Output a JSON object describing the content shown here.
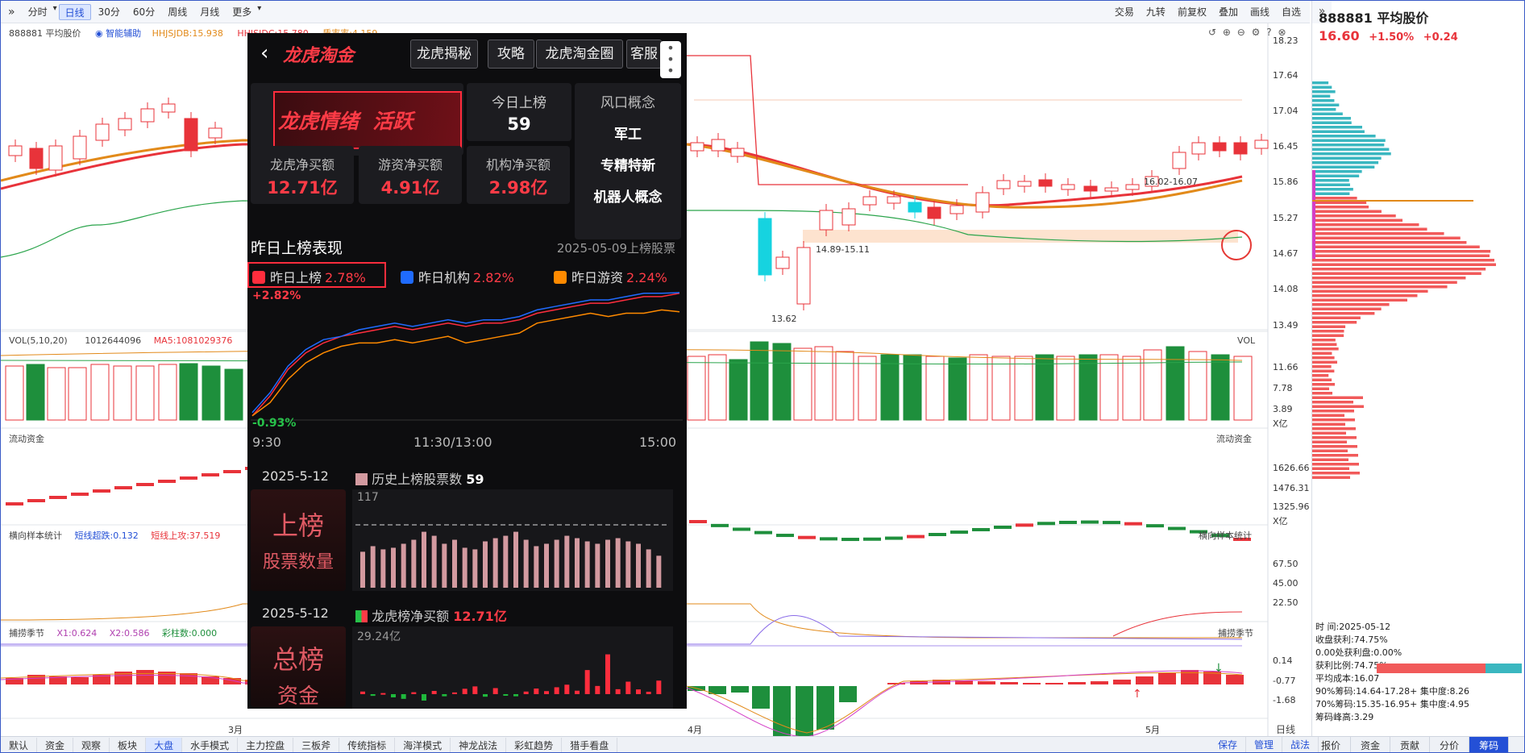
{
  "toolbar": {
    "left": [
      "分时",
      "日线",
      "30分",
      "60分",
      "周线",
      "月线",
      "更多"
    ],
    "active": "日线",
    "right": [
      "交易",
      "九转",
      "前复权",
      "叠加",
      "画线",
      "自选"
    ]
  },
  "chart_header": {
    "stock": "888881 平均股价",
    "assist": "智能辅助",
    "ind1": "HHJSJDB:15.938",
    "ind2": "HHJSJDC:15.780",
    "ind3": "质率率:4.159"
  },
  "price_axis": [
    "18.23",
    "17.64",
    "17.04",
    "16.45",
    "15.86",
    "15.27",
    "14.67",
    "14.08",
    "13.49"
  ],
  "price_notes": {
    "range1": "14.89-15.11",
    "range2": "16.02-16.07",
    "low": "13.62"
  },
  "vol": {
    "title": "VOL(5,10,20)",
    "v1": "1012644096",
    "ma5": "MA5:1081029376",
    "label": "VOL",
    "axis": [
      "11.66",
      "7.78",
      "3.89",
      "X亿"
    ]
  },
  "fund": {
    "title": "流动资金",
    "label": "流动资金",
    "axis": [
      "1626.66",
      "1476.31",
      "1325.96",
      "X亿"
    ]
  },
  "sample": {
    "title": "横向样本统计",
    "s1": "短线超跌:0.132",
    "s2": "短线上攻:37.519",
    "label": "横向样本统计",
    "axis": [
      "67.50",
      "45.00",
      "22.50"
    ]
  },
  "season": {
    "title": "捕捞季节",
    "x1": "X1:0.624",
    "x2": "X2:0.586",
    "c": "彩柱数:0.000",
    "label": "捕捞季节",
    "axis": [
      "0.14",
      "-0.77",
      "-1.68"
    ]
  },
  "months": [
    "3月",
    "4月",
    "5月"
  ],
  "timeframe": "日线",
  "overlay": {
    "title": "龙虎淘金",
    "buttons": [
      "龙虎揭秘",
      "攻略",
      "龙虎淘金圈",
      "客服"
    ],
    "mood": "龙虎情绪  活跃",
    "today_label": "今日上榜",
    "today_value": "59",
    "concept_title": "风口概念",
    "concepts": [
      "军工",
      "专精特新",
      "机器人概念"
    ],
    "stats": [
      {
        "label": "龙虎净买额",
        "value": "12.71亿"
      },
      {
        "label": "游资净买额",
        "value": "4.91亿"
      },
      {
        "label": "机构净买额",
        "value": "2.98亿"
      }
    ],
    "perf_title": "昨日上榜表现",
    "perf_date": "2025-05-09上榜股票",
    "legend": [
      {
        "name": "昨日上榜",
        "value": "2.78%",
        "color": "#ff2d3d"
      },
      {
        "name": "昨日机构",
        "value": "2.82%",
        "color": "#1f6bff"
      },
      {
        "name": "昨日游资",
        "value": "2.24%",
        "color": "#ff8a00"
      }
    ],
    "line_max": "+2.82%",
    "line_min": "-0.93%",
    "time_axis": [
      "9:30",
      "11:30/13:00",
      "15:00"
    ],
    "s1_date": "2025-5-12",
    "s1_legend": "历史上榜股票数",
    "s1_value": "59",
    "s1_tag1": "上榜",
    "s1_tag2": "股票数量",
    "s1_max": "117",
    "s2_date": "2025-5-12",
    "s2_legend": "龙虎榜净买额",
    "s2_value": "12.71亿",
    "s2_tag1": "总榜",
    "s2_tag2": "资金",
    "s2_max": "29.24亿"
  },
  "right_panel": {
    "code": "888881 平均股价",
    "price": "16.60",
    "change": "+1.50%",
    "change_abs": "+0.24",
    "info": [
      "时      间:2025-05-12",
      "收盘获利:74.75%",
      "0.00处获利盘:0.00%",
      "获利比例:74.75%",
      "平均成本:16.07",
      "90%筹码:14.64-17.28+ 集中度:8.26",
      "70%筹码:15.35-16.95+ 集中度:4.95",
      "筹码峰高:3.29"
    ],
    "tabs": [
      "报价",
      "资金",
      "贡献",
      "分价",
      "筹码"
    ],
    "active_tab": "筹码"
  },
  "bottom_tabs": [
    "默认",
    "资金",
    "观察",
    "板块",
    "大盘",
    "水手模式",
    "主力控盘",
    "三板斧",
    "传统指标",
    "海洋模式",
    "神龙战法",
    "彩虹趋势",
    "猎手看盘"
  ],
  "bottom_active": "大盘",
  "bottom_right": [
    "保存",
    "管理",
    "战法"
  ],
  "colors": {
    "up": "#e8333a",
    "down": "#1e8f3c",
    "accent": "#2450d6"
  },
  "chart_data": [
    {
      "type": "bar",
      "name": "s1",
      "values": [
        45,
        52,
        48,
        50,
        55,
        60,
        70,
        65,
        55,
        60,
        50,
        48,
        58,
        62,
        65,
        70,
        60,
        52,
        55,
        60,
        65,
        62,
        58,
        55,
        60,
        62,
        58,
        55,
        48,
        40
      ],
      "ylim": [
        0,
        117
      ],
      "max_label": "117"
    },
    {
      "type": "bar",
      "name": "s2",
      "values": [
        1.2,
        -0.8,
        0.5,
        -1.5,
        -2.2,
        0.9,
        -3,
        1.5,
        -1,
        0.8,
        2.5,
        3.6,
        -1.2,
        2.8,
        -0.6,
        -1,
        1.2,
        2.6,
        1.4,
        3.2,
        4.4,
        1.6,
        11.2,
        3.8,
        18.5,
        2.3,
        5.8,
        2.2,
        1.1,
        6.3
      ],
      "ylim": [
        -6,
        29.24
      ],
      "max_label": "29.24亿"
    },
    {
      "type": "line",
      "name": "perf",
      "series": [
        {
          "name": "昨日上榜",
          "values": [
            -0.9,
            -0.3,
            0.5,
            1.0,
            1.3,
            1.5,
            1.6,
            1.7,
            1.8,
            1.7,
            1.8,
            1.9,
            1.8,
            1.9,
            1.9,
            2.0,
            2.2,
            2.3,
            2.4,
            2.5,
            2.5,
            2.6,
            2.7,
            2.7,
            2.8
          ]
        },
        {
          "name": "昨日机构",
          "values": [
            -0.8,
            -0.2,
            0.6,
            1.1,
            1.4,
            1.5,
            1.7,
            1.8,
            1.9,
            1.8,
            1.9,
            2.0,
            1.9,
            2.0,
            2.0,
            2.1,
            2.3,
            2.4,
            2.5,
            2.6,
            2.6,
            2.7,
            2.8,
            2.8,
            2.82
          ]
        },
        {
          "name": "昨日游资",
          "values": [
            -0.9,
            -0.5,
            0.2,
            0.7,
            1.0,
            1.2,
            1.3,
            1.3,
            1.4,
            1.3,
            1.4,
            1.5,
            1.3,
            1.4,
            1.5,
            1.6,
            1.9,
            2.0,
            2.1,
            2.2,
            2.1,
            2.2,
            2.2,
            2.3,
            2.24
          ]
        }
      ],
      "ylim": [
        -0.93,
        2.82
      ]
    }
  ]
}
